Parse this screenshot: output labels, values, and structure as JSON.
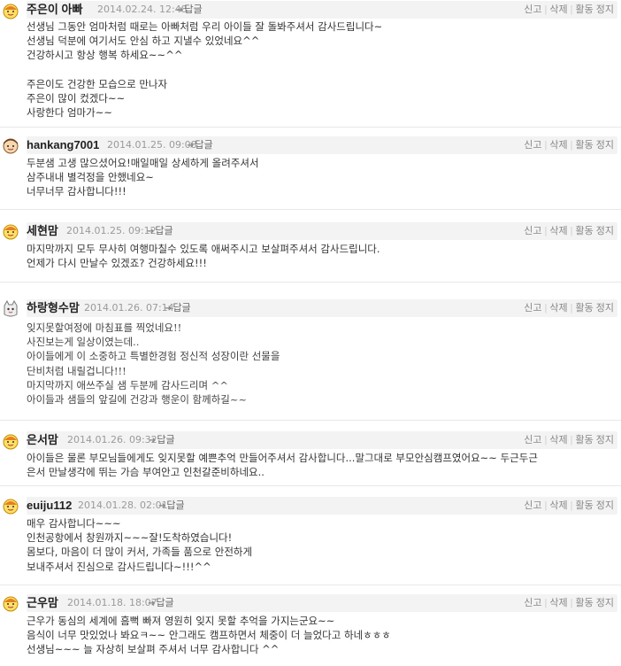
{
  "comments": [
    {
      "author": "주은이 아빠",
      "date": "2014.02.24. 12:48",
      "reply_label": "답글",
      "actions": [
        "신고",
        "삭제",
        "활동 정지"
      ],
      "text": "선생님 그동안 엄마처럼 때로는 아빠처럼 우리 아이들 잘 돌봐주셔서 감사드립니다~\n선생님 덕분에 여기서도 안심 하고 지낼수 있었네요^^\n건강하시고 항상 행복 하세요~~^^\n\n주은이도 건강한 모습으로 만나자\n주은이 많이 컸겠다~~\n사랑한다 엄마가~~"
    },
    {
      "author": "hankang7001",
      "date": "2014.01.25. 09:08",
      "reply_label": "답글",
      "actions": [
        "신고",
        "삭제",
        "활동 정지"
      ],
      "text": "두분샘 고생 많으셨어요!매일매일 상세하게 올려주셔서\n삼주내내 별걱정을 안했네요~\n너무너무 감사합니다!!!"
    },
    {
      "author": "세현맘",
      "date": "2014.01.25. 09:12",
      "reply_label": "답글",
      "actions": [
        "신고",
        "삭제",
        "활동 정지"
      ],
      "text": "마지막까지 모두 무사히 여행마칠수 있도록 애써주시고 보살펴주셔서 감사드립니다.\n언제가 다시 만날수 있겠죠? 건강하세요!!!"
    },
    {
      "author": "하랑형수맘",
      "date": "2014.01.26. 07:14",
      "reply_label": "답글",
      "actions": [
        "신고",
        "삭제",
        "활동 정지"
      ],
      "text": "잊지못할여정에 마침표를 찍었네요!!\n사진보는게 일상이였는데..\n아이들에게 이 소중하고 특별한경험 정신적 성장이란 선물을\n단비처럼 내릴겁니다!!!\n마지막까지 애쓰주실 샘 두분께 감사드리며 ^^\n아이들과 샘들의 앞길에 건강과 행운이 함께하길~~"
    },
    {
      "author": "은서맘",
      "date": "2014.01.26. 09:32",
      "reply_label": "답글",
      "actions": [
        "신고",
        "삭제",
        "활동 정지"
      ],
      "text": "아이들은 물론 부모님들에게도 잊지못할 예쁜추억 만들어주셔서 감사합니다...말그대로 부모안심캠프였어요~~ 두근두근\n은서 만날생각에 뛰는 가슴 부여안고 인천갈준비하네요.."
    },
    {
      "author": "euiju112",
      "date": "2014.01.28. 02:01",
      "reply_label": "답글",
      "actions": [
        "신고",
        "삭제",
        "활동 정지"
      ],
      "text": "매우 감사합니다~~~\n인천공항에서 창원까지~~~잘!도착하였습니다!\n몸보다, 마음이 더 많이 커서, 가족들 품으로 안전하게\n보내주셔서 진심으로 감사드립니다~!!!^^"
    },
    {
      "author": "근우맘",
      "date": "2014.01.18. 18:07",
      "reply_label": "답글",
      "actions": [
        "신고",
        "삭제",
        "활동 정지"
      ],
      "text": "근우가 동심의 세계에 흠뻑 빠져 영원히 잊지 못할 추억을 가지는군요~~\n음식이 너무 맛있었나 봐요ㅋ~~ 안그래도 캠프하면서 체중이 더 늘었다고 하네ㅎㅎㅎ\n선생님~~~ 늘 자상히 보살펴 주셔서 너무 감사합니다 ^^"
    }
  ],
  "colors": {
    "header_bg": "#f3f3f3",
    "date": "#9a9a9a",
    "text": "#333333"
  }
}
